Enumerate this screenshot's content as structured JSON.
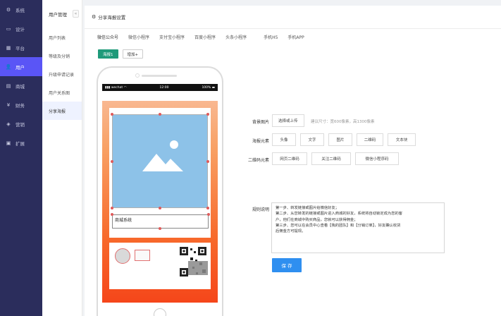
{
  "sidebar": {
    "items": [
      {
        "label": "系统",
        "icon": "gear-icon"
      },
      {
        "label": "设计",
        "icon": "monitor-icon"
      },
      {
        "label": "平台",
        "icon": "grid-icon"
      },
      {
        "label": "用户",
        "icon": "user-icon"
      },
      {
        "label": "商城",
        "icon": "shop-icon"
      },
      {
        "label": "财务",
        "icon": "money-icon"
      },
      {
        "label": "营销",
        "icon": "megaphone-icon"
      },
      {
        "label": "扩展",
        "icon": "puzzle-icon"
      }
    ],
    "active_index": 3,
    "accent_color": "#5a55f6",
    "bg_color": "#2b2d5c"
  },
  "submenu": {
    "title": "用户管理",
    "collapse_glyph": "«",
    "items": [
      "用户列表",
      "等级及分销",
      "升级申请记录",
      "用户关系图",
      "分享海报"
    ],
    "active_index": 4
  },
  "panel": {
    "title": "分享海报设置",
    "tabs": [
      "微信公众号",
      "微信小程序",
      "支付宝小程序",
      "百度小程序",
      "头条小程序",
      "手机H5",
      "手机APP"
    ],
    "active_tab": 0,
    "buttons": {
      "primary": "海报1",
      "add": "增加+"
    }
  },
  "phone": {
    "status": {
      "carrier": "wechat",
      "time": "12:00",
      "battery": "100%"
    },
    "poster_title": "商城系统",
    "screen_color": "#f76a2c"
  },
  "form": {
    "bg_image_label": "背景图片",
    "bg_upload_button": "选择或上传",
    "bg_hint": "建议尺寸：宽600像素，高1300像素",
    "element_label": "海报元素",
    "element_buttons": [
      "头像",
      "文字",
      "图片",
      "二维码",
      "文本块"
    ],
    "qr_label": "二维码元素",
    "qr_buttons": [
      "网页二维码",
      "关注二维码",
      "微信小程序码"
    ],
    "rule_label": "规则说明",
    "rule_lines": [
      "第一步、转发链接或图片给微信好友；",
      "第二步、从您转发的链接或图片进入商城的好友，系统将自动锁定成为您的客",
      "户，他们在商城中购买商品，您就可以获得佣金；",
      "第三步、您可以在会员中心查看【我的团队】和【分销订单】，好友确认收货",
      "后佣金方可提现。"
    ],
    "save_button": "保 存",
    "save_color": "#2f8ff0"
  }
}
